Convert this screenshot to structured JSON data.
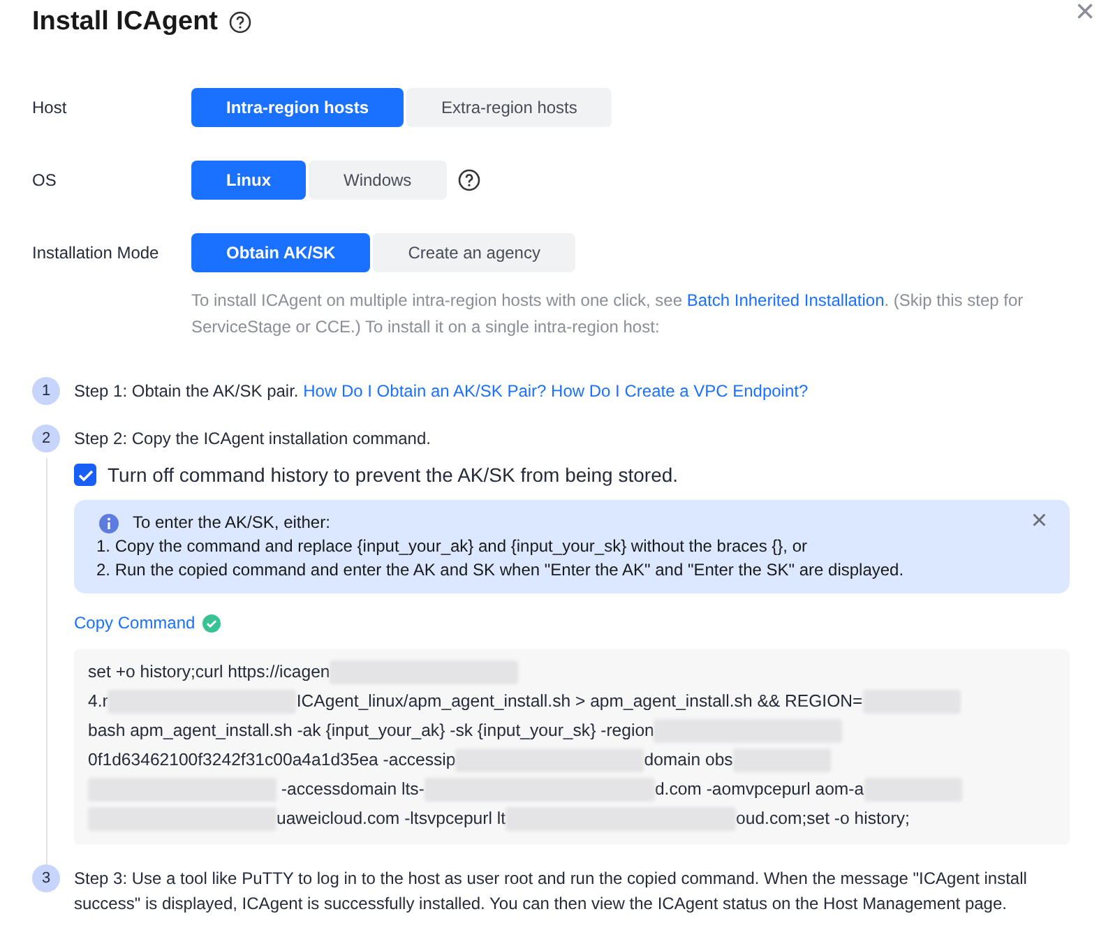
{
  "dialog": {
    "title": "Install ICAgent",
    "close_symbol": "×"
  },
  "form": [
    {
      "label": "Host",
      "help": false,
      "options": [
        {
          "label": "Intra-region hosts",
          "selected": true
        },
        {
          "label": "Extra-region hosts",
          "selected": false
        }
      ]
    },
    {
      "label": "OS",
      "help": true,
      "options": [
        {
          "label": "Linux",
          "selected": true
        },
        {
          "label": "Windows",
          "selected": false
        }
      ]
    },
    {
      "label": "Installation Mode",
      "help": false,
      "options": [
        {
          "label": "Obtain AK/SK",
          "selected": true
        },
        {
          "label": "Create an agency",
          "selected": false
        }
      ]
    }
  ],
  "description": {
    "before": "To install ICAgent on multiple intra-region hosts with one click, see ",
    "link": "Batch Inherited Installation",
    "after": ". (Skip this step for ServiceStage or CCE.) To install it on a single intra-region host:"
  },
  "steps": [
    {
      "number": "1",
      "text": "Step 1: Obtain the AK/SK pair.",
      "link": "How Do I Obtain an AK/SK Pair? How Do I Create a VPC Endpoint?"
    },
    {
      "number": "2",
      "text": "Step 2: Copy the ICAgent installation command.",
      "checkbox": {
        "label": "Turn off command history to prevent the AK/SK from being stored.",
        "checked": true
      },
      "notice": {
        "title": "To enter the AK/SK, either:",
        "lines": [
          "1. Copy the command and replace {input_your_ak} and {input_your_sk} without the braces {}, or",
          "2. Run the copied command and enter the AK and SK when \"Enter the AK\" and \"Enter the SK\" are displayed."
        ]
      },
      "copy_link": "Copy Command",
      "command_lines": [
        [
          {
            "kind": "text",
            "text": "set +o history;curl https://icagen"
          },
          {
            "kind": "redacted"
          }
        ],
        [
          {
            "kind": "text",
            "text": "4.r"
          },
          {
            "kind": "redacted"
          },
          {
            "kind": "text",
            "text": "ICAgent_linux/apm_agent_install.sh > apm_agent_install.sh && REGION="
          },
          {
            "kind": "redacted"
          }
        ],
        [
          {
            "kind": "text",
            "text": "bash apm_agent_install.sh -ak {input_your_ak} -sk {input_your_sk} -region"
          },
          {
            "kind": "redacted"
          }
        ],
        [
          {
            "kind": "text",
            "text": "0f1d63462100f3242f31c00a4a1d35ea -accessip"
          },
          {
            "kind": "redacted"
          },
          {
            "kind": "text",
            "text": "domain obs"
          },
          {
            "kind": "redacted"
          }
        ],
        [
          {
            "kind": "redacted"
          },
          {
            "kind": "text",
            "text": " -accessdomain lts-"
          },
          {
            "kind": "redacted"
          },
          {
            "kind": "text",
            "text": "d.com -aomvpcepurl aom-a"
          },
          {
            "kind": "redacted"
          }
        ],
        [
          {
            "kind": "redacted"
          },
          {
            "kind": "text",
            "text": "uaweicloud.com -ltsvpcepurl lt"
          },
          {
            "kind": "redacted"
          },
          {
            "kind": "text",
            "text": "oud.com;set -o history;"
          }
        ]
      ]
    },
    {
      "number": "3",
      "text": "Step 3: Use a tool like PuTTY to log in to the host as user root and run the copied command. When the message \"ICAgent install success\" is displayed, ICAgent is successfully installed. You can then view the ICAgent status on the Host Management page."
    }
  ]
}
